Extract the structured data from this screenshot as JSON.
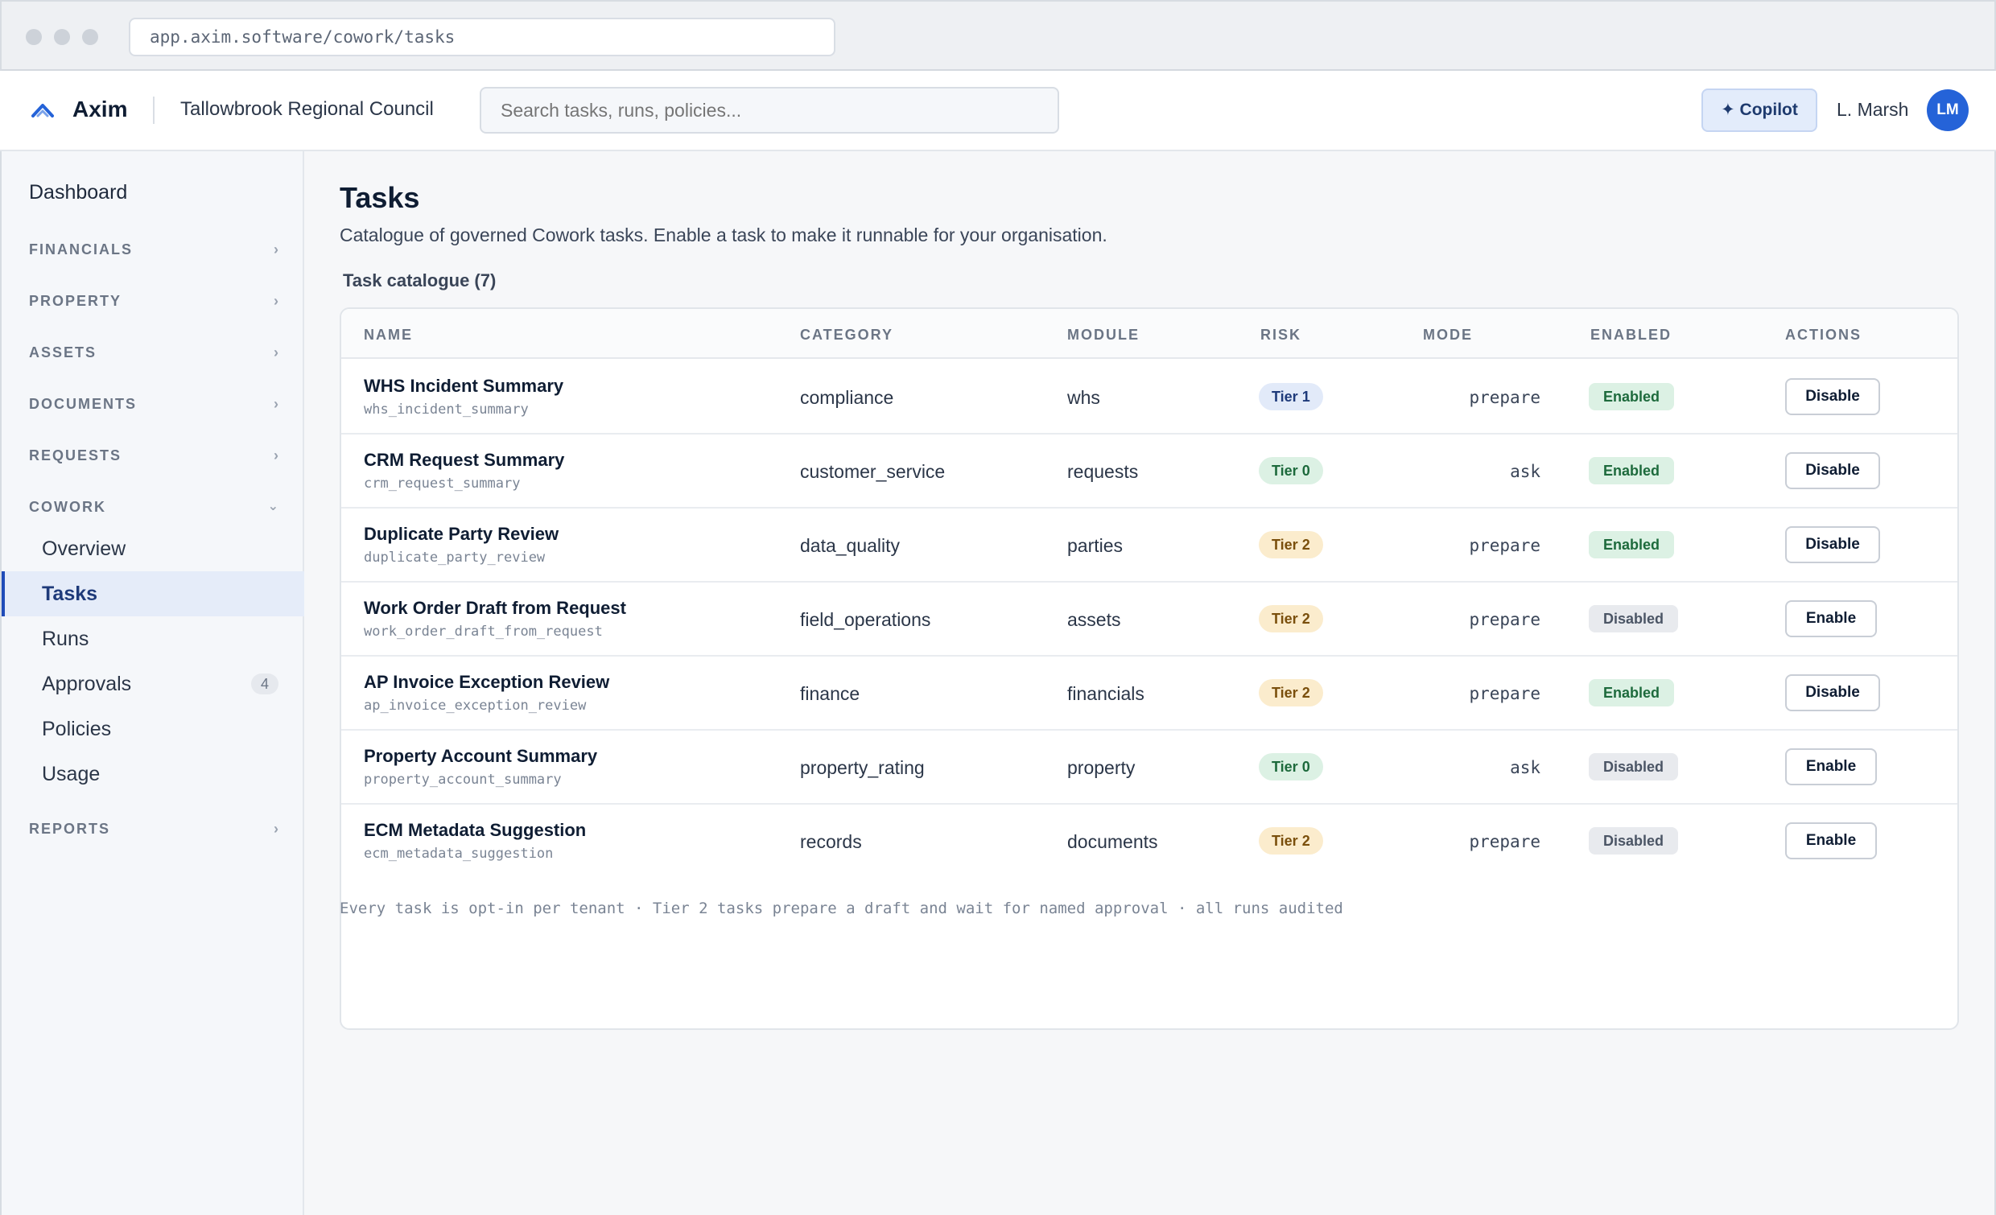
{
  "browser": {
    "url": "app.axim.software/cowork/tasks"
  },
  "header": {
    "brand": "Axim",
    "org": "Tallowbrook Regional Council",
    "search_placeholder": "Search tasks, runs, policies...",
    "copilot_label": "✦ Copilot",
    "user_name": "L. Marsh",
    "avatar_initials": "LM",
    "accent_color": "#2563d8"
  },
  "sidebar": {
    "dashboard": "Dashboard",
    "sections": {
      "financials": "FINANCIALS",
      "property": "PROPERTY",
      "assets": "ASSETS",
      "documents": "DOCUMENTS",
      "requests": "REQUESTS",
      "cowork": "COWORK",
      "reports": "REPORTS"
    },
    "cowork_items": [
      {
        "label": "Overview"
      },
      {
        "label": "Tasks",
        "active": true
      },
      {
        "label": "Runs"
      },
      {
        "label": "Approvals",
        "count": "4"
      },
      {
        "label": "Policies"
      },
      {
        "label": "Usage"
      }
    ]
  },
  "page": {
    "title": "Tasks",
    "subtitle": "Catalogue of governed Cowork tasks. Enable a task to make it runnable for your organisation.",
    "catalogue_label": "Task catalogue (7)",
    "footnote": "Every task is opt-in per tenant · Tier 2 tasks prepare a draft and wait for named approval · all runs audited"
  },
  "table": {
    "columns": [
      "NAME",
      "CATEGORY",
      "MODULE",
      "RISK",
      "MODE",
      "ENABLED",
      "ACTIONS"
    ],
    "rows": [
      {
        "name": "WHS Incident Summary",
        "key": "whs_incident_summary",
        "category": "compliance",
        "module": "whs",
        "risk": "Tier 1",
        "mode": "prepare",
        "status": "Enabled",
        "action": "Disable"
      },
      {
        "name": "CRM Request Summary",
        "key": "crm_request_summary",
        "category": "customer_service",
        "module": "requests",
        "risk": "Tier 0",
        "mode": "ask",
        "status": "Enabled",
        "action": "Disable"
      },
      {
        "name": "Duplicate Party Review",
        "key": "duplicate_party_review",
        "category": "data_quality",
        "module": "parties",
        "risk": "Tier 2",
        "mode": "prepare",
        "status": "Enabled",
        "action": "Disable"
      },
      {
        "name": "Work Order Draft from Request",
        "key": "work_order_draft_from_request",
        "category": "field_operations",
        "module": "assets",
        "risk": "Tier 2",
        "mode": "prepare",
        "status": "Disabled",
        "action": "Enable"
      },
      {
        "name": "AP Invoice Exception Review",
        "key": "ap_invoice_exception_review",
        "category": "finance",
        "module": "financials",
        "risk": "Tier 2",
        "mode": "prepare",
        "status": "Enabled",
        "action": "Disable"
      },
      {
        "name": "Property Account Summary",
        "key": "property_account_summary",
        "category": "property_rating",
        "module": "property",
        "risk": "Tier 0",
        "mode": "ask",
        "status": "Disabled",
        "action": "Enable"
      },
      {
        "name": "ECM Metadata Suggestion",
        "key": "ecm_metadata_suggestion",
        "category": "records",
        "module": "documents",
        "risk": "Tier 2",
        "mode": "prepare",
        "status": "Disabled",
        "action": "Enable"
      }
    ]
  }
}
